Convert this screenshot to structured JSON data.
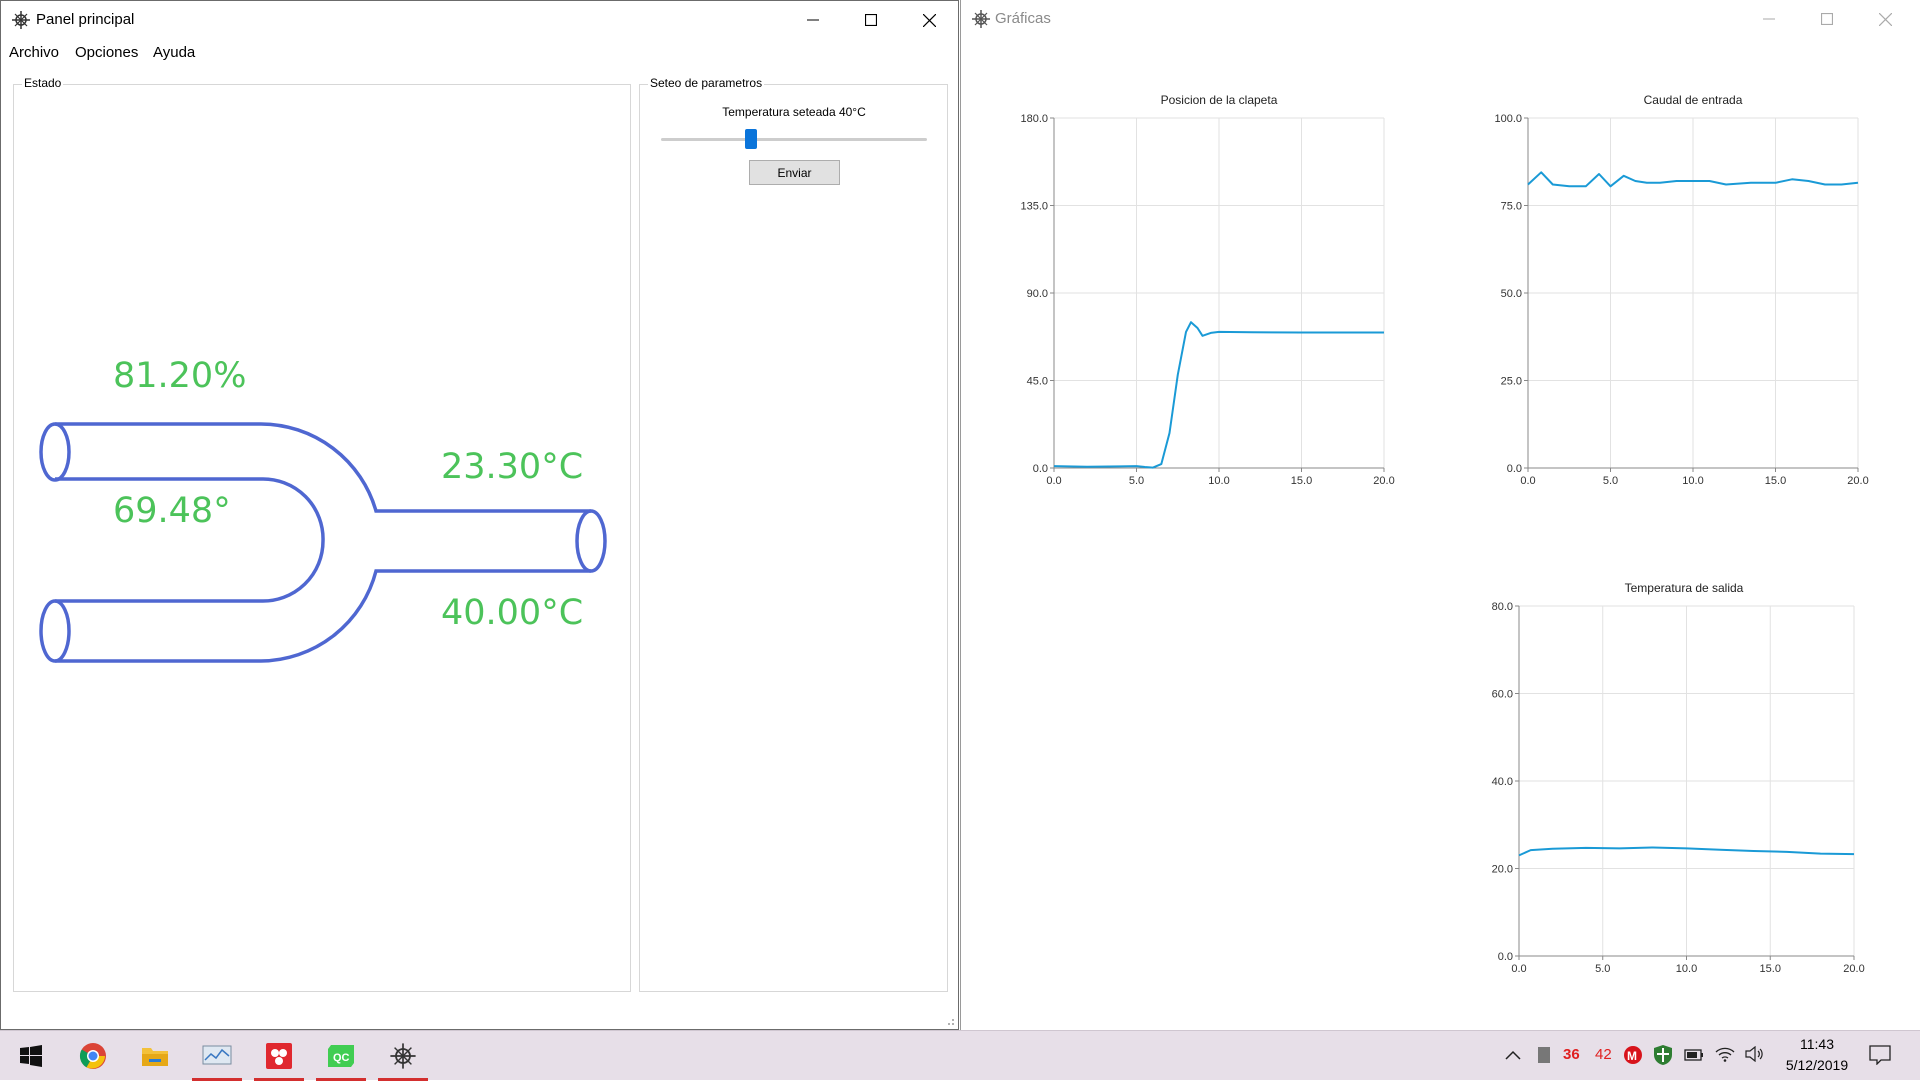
{
  "panel": {
    "title": "Panel principal",
    "menu": [
      "Archivo",
      "Opciones",
      "Ayuda"
    ],
    "estado_label": "Estado",
    "gauges": {
      "caudal": "81.20%",
      "clapeta": "69.48°",
      "temp_salida": "23.30°C",
      "temp_set": "40.00°C"
    },
    "pipe_color": "#4f67d1",
    "gauge_color": "#4cc35a",
    "params": {
      "group_label": "Seteo de parametros",
      "slider_label": "Temperatura seteada 40°C",
      "slider_fraction": 0.34,
      "button_label": "Enviar"
    }
  },
  "graficas": {
    "title": "Gráficas"
  },
  "chart_data": [
    {
      "type": "line",
      "title": "Posicion de la clapeta",
      "xlim": [
        0,
        20
      ],
      "ylim": [
        0,
        180
      ],
      "xticks": [
        "0.0",
        "5.0",
        "10.0",
        "15.0",
        "20.0"
      ],
      "yticks": [
        "0.0",
        "45.0",
        "90.0",
        "135.0",
        "180.0"
      ],
      "color": "#1a9ad6",
      "x": [
        0,
        2,
        4,
        5,
        5.5,
        6,
        6.5,
        7,
        7.5,
        8,
        8.3,
        8.7,
        9,
        9.5,
        10,
        12,
        15,
        20
      ],
      "y": [
        1.0,
        0.6,
        0.8,
        1.0,
        0.5,
        0.2,
        2.0,
        18.0,
        48.0,
        70.0,
        75.0,
        72.0,
        68.0,
        69.5,
        70.0,
        69.8,
        69.7,
        69.7
      ]
    },
    {
      "type": "line",
      "title": "Caudal de entrada",
      "xlim": [
        0,
        20
      ],
      "ylim": [
        0,
        100
      ],
      "xticks": [
        "0.0",
        "5.0",
        "10.0",
        "15.0",
        "20.0"
      ],
      "yticks": [
        "0.0",
        "25.0",
        "50.0",
        "75.0",
        "100.0"
      ],
      "color": "#1a9ad6",
      "x": [
        0,
        0.8,
        1.5,
        2.5,
        3.5,
        4.3,
        5.0,
        5.8,
        6.5,
        7.2,
        8.0,
        9.0,
        10.0,
        11.0,
        12.0,
        13.5,
        15.0,
        16.0,
        17.0,
        18.0,
        19.0,
        20.0
      ],
      "y": [
        81.0,
        84.5,
        81.0,
        80.5,
        80.5,
        84.0,
        80.5,
        83.5,
        82.0,
        81.5,
        81.5,
        82.0,
        82.0,
        82.0,
        81.0,
        81.5,
        81.5,
        82.5,
        82.0,
        81.0,
        81.0,
        81.5
      ]
    },
    {
      "type": "line",
      "title": "Temperatura de salida",
      "xlim": [
        0,
        20
      ],
      "ylim": [
        0,
        80
      ],
      "xticks": [
        "0.0",
        "5.0",
        "10.0",
        "15.0",
        "20.0"
      ],
      "yticks": [
        "0.0",
        "20.0",
        "40.0",
        "60.0",
        "80.0"
      ],
      "color": "#1a9ad6",
      "x": [
        0,
        0.7,
        2,
        4,
        6,
        8,
        10,
        12,
        14,
        16,
        18,
        20
      ],
      "y": [
        23.0,
        24.2,
        24.5,
        24.7,
        24.6,
        24.8,
        24.6,
        24.3,
        24.0,
        23.8,
        23.4,
        23.3
      ]
    }
  ],
  "taskbar": {
    "apps": [
      "windows-start",
      "chrome",
      "file-explorer",
      "monitor-app",
      "red-app",
      "qt-creator",
      "python-app"
    ],
    "tray_num1": "36",
    "tray_num2": "42",
    "time": "11:43",
    "date": "5/12/2019"
  }
}
